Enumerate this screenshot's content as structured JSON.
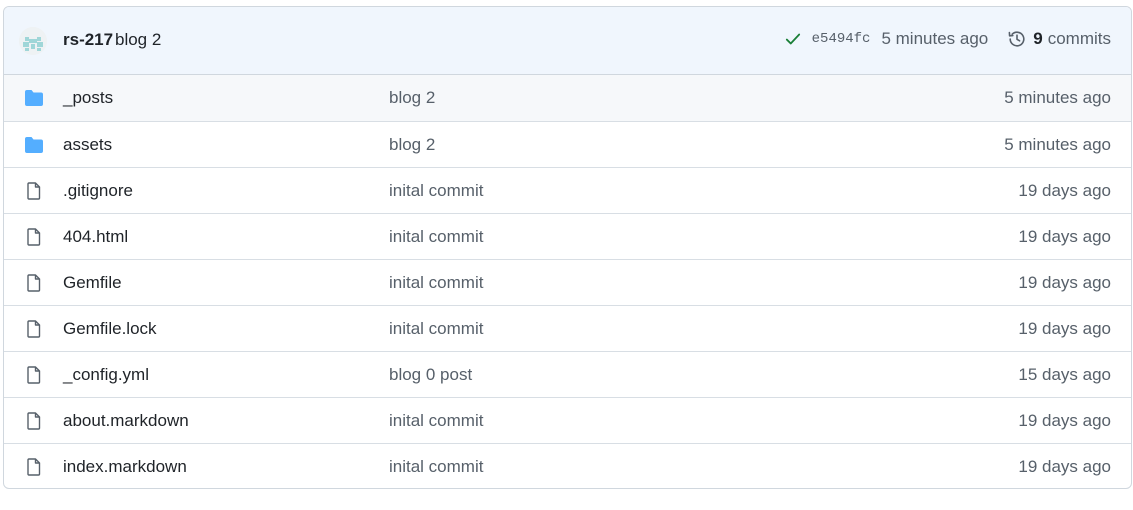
{
  "latest_commit": {
    "author": "rs-217",
    "message": "blog 2",
    "status": "success",
    "sha": "e5494fc",
    "time_ago": "5 minutes ago",
    "commit_count": "9",
    "commits_label": "commits"
  },
  "colors": {
    "header_bg": "#f0f6fd",
    "folder": "#54aeff",
    "success": "#1a7f37",
    "muted": "#57606a",
    "border": "#d0d7de"
  },
  "files": [
    {
      "type": "folder",
      "icon": "folder-icon",
      "name": "_posts",
      "message": "blog 2",
      "age": "5 minutes ago"
    },
    {
      "type": "folder",
      "icon": "folder-icon",
      "name": "assets",
      "message": "blog 2",
      "age": "5 minutes ago"
    },
    {
      "type": "file",
      "icon": "file-icon",
      "name": ".gitignore",
      "message": "inital commit",
      "age": "19 days ago"
    },
    {
      "type": "file",
      "icon": "file-icon",
      "name": "404.html",
      "message": "inital commit",
      "age": "19 days ago"
    },
    {
      "type": "file",
      "icon": "file-icon",
      "name": "Gemfile",
      "message": "inital commit",
      "age": "19 days ago"
    },
    {
      "type": "file",
      "icon": "file-icon",
      "name": "Gemfile.lock",
      "message": "inital commit",
      "age": "19 days ago"
    },
    {
      "type": "file",
      "icon": "file-icon",
      "name": "_config.yml",
      "message": "blog 0 post",
      "age": "15 days ago"
    },
    {
      "type": "file",
      "icon": "file-icon",
      "name": "about.markdown",
      "message": "inital commit",
      "age": "19 days ago"
    },
    {
      "type": "file",
      "icon": "file-icon",
      "name": "index.markdown",
      "message": "inital commit",
      "age": "19 days ago"
    }
  ]
}
